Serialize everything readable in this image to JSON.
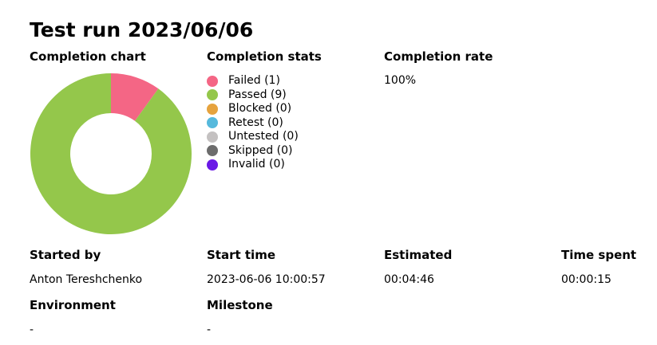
{
  "page": {
    "title": "Test run 2023/06/06"
  },
  "completion": {
    "chart_label": "Completion chart",
    "stats_label": "Completion stats",
    "rate_label": "Completion rate",
    "rate_value": "100%"
  },
  "legend": [
    {
      "label": "Failed (1)",
      "color": "#f46685"
    },
    {
      "label": "Passed (9)",
      "color": "#94c74b"
    },
    {
      "label": "Blocked (0)",
      "color": "#e6a33e"
    },
    {
      "label": "Retest (0)",
      "color": "#56b9dc"
    },
    {
      "label": "Untested (0)",
      "color": "#c4c1c1"
    },
    {
      "label": "Skipped (0)",
      "color": "#6c6c6c"
    },
    {
      "label": "Invalid (0)",
      "color": "#6a19e6"
    }
  ],
  "chart_data": {
    "type": "pie",
    "donut": true,
    "slices": [
      {
        "label": "Failed",
        "value": 1,
        "color": "#f46685"
      },
      {
        "label": "Passed",
        "value": 9,
        "color": "#94c74b"
      }
    ]
  },
  "details": {
    "started_by_label": "Started by",
    "started_by_value": "Anton Tereshchenko",
    "start_time_label": "Start time",
    "start_time_value": "2023-06-06 10:00:57",
    "estimated_label": "Estimated",
    "estimated_value": "00:04:46",
    "time_spent_label": "Time spent",
    "time_spent_value": "00:00:15",
    "environment_label": "Environment",
    "environment_value": "-",
    "milestone_label": "Milestone",
    "milestone_value": "-"
  }
}
